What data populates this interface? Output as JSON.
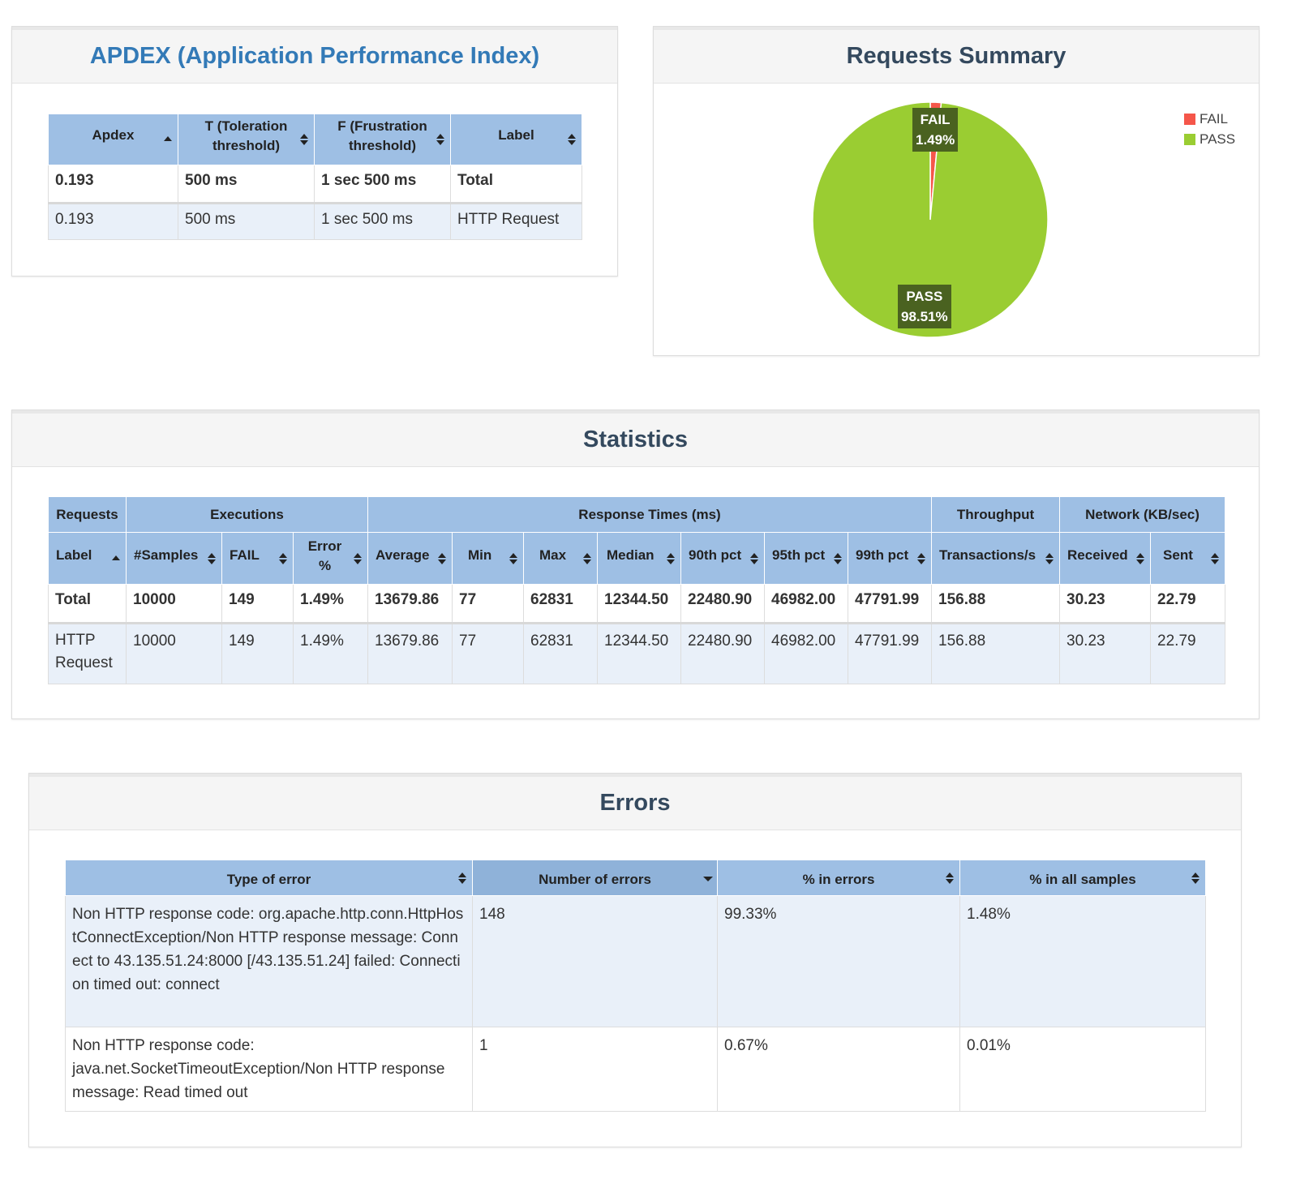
{
  "apdex": {
    "title": "APDEX (Application Performance Index)",
    "headers": [
      "Apdex",
      "T (Toleration threshold)",
      "F (Frustration threshold)",
      "Label"
    ],
    "rows": [
      [
        "0.193",
        "500 ms",
        "1 sec 500 ms",
        "Total"
      ],
      [
        "0.193",
        "500 ms",
        "1 sec 500 ms",
        "HTTP Request"
      ]
    ]
  },
  "summary": {
    "title": "Requests Summary",
    "legend": [
      {
        "label": "FAIL",
        "color": "#f5564a"
      },
      {
        "label": "PASS",
        "color": "#9acd32"
      }
    ],
    "slice_labels": {
      "fail": {
        "name": "FAIL",
        "pct": "1.49%"
      },
      "pass": {
        "name": "PASS",
        "pct": "98.51%"
      }
    }
  },
  "chart_data": {
    "type": "pie",
    "categories": [
      "FAIL",
      "PASS"
    ],
    "values": [
      1.49,
      98.51
    ],
    "colors": [
      "#f5564a",
      "#9acd32"
    ],
    "legend_position": "top-right"
  },
  "statistics": {
    "title": "Statistics",
    "groups": [
      "Requests",
      "Executions",
      "Response Times (ms)",
      "Throughput",
      "Network (KB/sec)"
    ],
    "headers": [
      "Label",
      "#Samples",
      "FAIL",
      "Error %",
      "Average",
      "Min",
      "Max",
      "Median",
      "90th pct",
      "95th pct",
      "99th pct",
      "Transactions/s",
      "Received",
      "Sent"
    ],
    "rows": [
      [
        "Total",
        "10000",
        "149",
        "1.49%",
        "13679.86",
        "77",
        "62831",
        "12344.50",
        "22480.90",
        "46982.00",
        "47791.99",
        "156.88",
        "30.23",
        "22.79"
      ],
      [
        "HTTP Request",
        "10000",
        "149",
        "1.49%",
        "13679.86",
        "77",
        "62831",
        "12344.50",
        "22480.90",
        "46982.00",
        "47791.99",
        "156.88",
        "30.23",
        "22.79"
      ]
    ]
  },
  "errors": {
    "title": "Errors",
    "headers": [
      "Type of error",
      "Number of errors",
      "% in errors",
      "% in all samples"
    ],
    "rows": [
      [
        "Non HTTP response code: org.apache.http.conn.HttpHostConnectException/Non HTTP response message: Connect to 43.135.51.24:8000 [/43.135.51.24] failed: Connection timed out: connect",
        "148",
        "99.33%",
        "1.48%"
      ],
      [
        "Non HTTP response code: java.net.SocketTimeoutException/Non HTTP response message: Read timed out",
        "1",
        "0.67%",
        "0.01%"
      ]
    ]
  }
}
